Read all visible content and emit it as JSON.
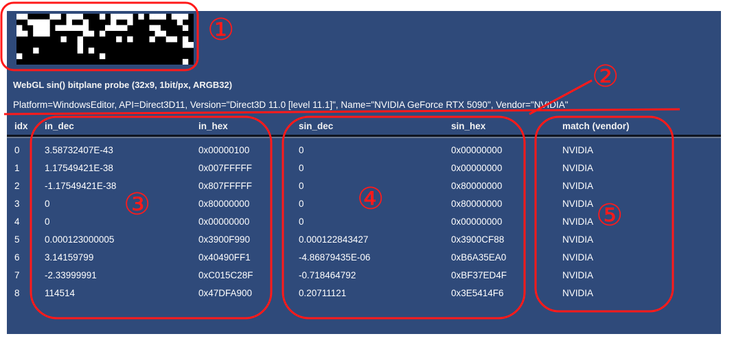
{
  "header": {
    "title": "WebGL sin() bitplane probe (32x9, 1bit/px, ARGB32)",
    "platform": "Platform=WindowsEditor, API=Direct3D11, Version=\"Direct3D 11.0 [level 11.1]\", Name=\"NVIDIA GeForce RTX 5090\", Vendor=\"NVIDIA\""
  },
  "table": {
    "columns": [
      "idx",
      "in_dec",
      "in_hex",
      "sin_dec",
      "sin_hex",
      "match (vendor)"
    ],
    "rows": [
      [
        "0",
        "3.58732407E-43",
        "0x00000100",
        "0",
        "0x00000000",
        "NVIDIA"
      ],
      [
        "1",
        "1.17549421E-38",
        "0x007FFFFF",
        "0",
        "0x00000000",
        "NVIDIA"
      ],
      [
        "2",
        "-1.17549421E-38",
        "0x807FFFFF",
        "0",
        "0x80000000",
        "NVIDIA"
      ],
      [
        "3",
        "0",
        "0x80000000",
        "0",
        "0x80000000",
        "NVIDIA"
      ],
      [
        "4",
        "0",
        "0x00000000",
        "0",
        "0x00000000",
        "NVIDIA"
      ],
      [
        "5",
        "0.000123000005",
        "0x3900F990",
        "0.000122843427",
        "0x3900CF88",
        "NVIDIA"
      ],
      [
        "6",
        "3.14159799",
        "0x40490FF1",
        "-4.86879435E-06",
        "0xB6A35EA0",
        "NVIDIA"
      ],
      [
        "7",
        "-2.33999991",
        "0xC015C28F",
        "-0.718464792",
        "0xBF37ED4F",
        "NVIDIA"
      ],
      [
        "8",
        "114514",
        "0x47DFA900",
        "0.20711121",
        "0x3E5414F6",
        "NVIDIA"
      ]
    ]
  },
  "annotations": {
    "labels": [
      "①",
      "②",
      "③",
      "④",
      "⑤"
    ],
    "color": "#ff1a1a"
  },
  "colors": {
    "panel_background": "#2f4a7a",
    "text": "#ffffff"
  }
}
